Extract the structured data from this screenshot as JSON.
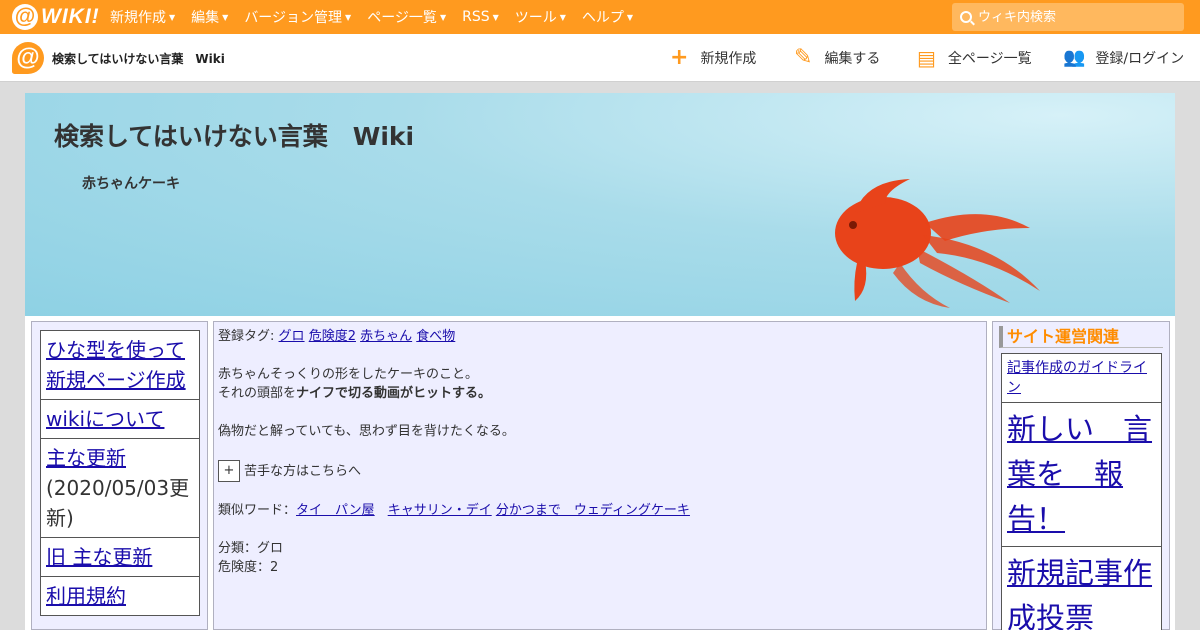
{
  "topbar": {
    "logo_text": "WIKI!",
    "menu": [
      {
        "label": "新規作成"
      },
      {
        "label": "編集"
      },
      {
        "label": "バージョン管理"
      },
      {
        "label": "ページ一覧"
      },
      {
        "label": "RSS"
      },
      {
        "label": "ツール"
      },
      {
        "label": "ヘルプ"
      }
    ],
    "search_placeholder": "ウィキ内検索"
  },
  "subbar": {
    "site_title": "検索してはいけない言葉　Wiki",
    "actions": {
      "new": "新規作成",
      "edit": "編集する",
      "all_pages": "全ページ一覧",
      "login": "登録/ログイン"
    }
  },
  "banner": {
    "title": "検索してはいけない言葉　Wiki",
    "subtitle": "赤ちゃんケーキ"
  },
  "left_menu": [
    {
      "label": "ひな型を使って新規ページ作成"
    },
    {
      "label": "wikiについて"
    },
    {
      "label": "主な更新",
      "note": "(2020/05/03更新)"
    },
    {
      "label": "旧 主な更新"
    },
    {
      "label": "利用規約"
    }
  ],
  "main": {
    "tags_label": "登録タグ:",
    "tags": [
      "グロ",
      "危険度2",
      "赤ちゃん",
      "食べ物"
    ],
    "desc1": "赤ちゃんそっくりの形をしたケーキのこと。",
    "desc2_prefix": "それの頭部を",
    "desc2_bold": "ナイフで切る動画がヒットする。",
    "desc3": "偽物だと解っていても、思わず目を背けたくなる。",
    "toggle_symbol": "+",
    "toggle_label": "苦手な方はこちらへ",
    "similar_label": "類似ワード：",
    "similar": [
      "タイ　パン屋",
      "キャサリン・デイ",
      "分かつまで　ウェディングケーキ"
    ],
    "category": "分類：グロ",
    "danger": "危険度：2"
  },
  "right_menu": {
    "heading": "サイト運営関連",
    "items": [
      {
        "label": "記事作成のガイドライン"
      },
      {
        "label": "新しい　言葉を　報告！"
      },
      {
        "label": "新規記事作成投票"
      }
    ]
  },
  "colors": {
    "accent": "#ff9a1f",
    "link": "#1a0dab",
    "panel": "#eeeeff",
    "fish": "#e8431a"
  }
}
